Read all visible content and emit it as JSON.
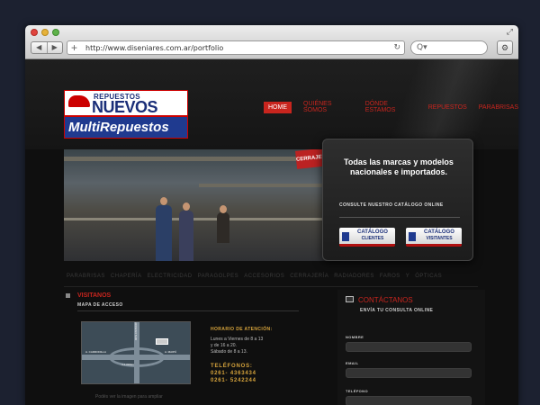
{
  "browser": {
    "url": "http://www.diseniares.com.ar/portfolio",
    "back_icon": "◀",
    "forward_icon": "▶",
    "add_icon": "+",
    "reload_icon": "↻",
    "search_icon": "Q▾",
    "settings_icon": "⚙",
    "fullscreen_icon": "⤢"
  },
  "logo": {
    "top_small": "REPUESTOS",
    "top_big": "NUEVOS",
    "bottom": "MultiRepuestos"
  },
  "nav": [
    "HOME",
    "QUIÉNES SOMOS",
    "DÓNDE ESTAMOS",
    "REPUESTOS",
    "PARABRISAS"
  ],
  "hero": {
    "sign": "CERRAJERÍA",
    "panel_title": "Todas las marcas y modelos nacionales e importados.",
    "panel_sub": "CONSULTE NUESTRO CATÁLOGO ONLINE",
    "btn_clientes_l1": "CATÁLOGO",
    "btn_clientes_l2": "CLIENTES",
    "btn_visitantes_l1": "CATÁLOGO",
    "btn_visitantes_l2": "VISITANTES"
  },
  "categories": [
    "PARABRISAS",
    "CHAPERÍA",
    "ELECTRICIDAD",
    "PARAGOLPES",
    "ACCESORIOS",
    "CERRAJERÍA",
    "RADIADORES",
    "FAROS",
    "Y",
    "ÓPTICAS"
  ],
  "visitantes": {
    "title": "VISITANOS",
    "mapa": "MAPA DE ACCESO",
    "map_labels": [
      "A. CARRODILLA",
      "J.J. PASO",
      "A. MAIPÚ",
      "ACCESO SUR"
    ],
    "horario_title": "HORARIO DE ATENCIÓN:",
    "horario_lines": [
      "Lunes a Viernes de 8 a 13",
      "y de 16 a 20.",
      "Sábado de 8 a 13."
    ],
    "tel_title": "TELÉFONOS:",
    "tel_lines": [
      "0261- 4363434",
      "0261- 5242244"
    ],
    "caption": "Podés ver la imagen para ampliar"
  },
  "contact": {
    "title": "CONTÁCTANOS",
    "sub": "ENVÍA TU CONSULTA ONLINE",
    "fields": [
      "NOMBRE",
      "EMAIL",
      "TELÉFONO"
    ]
  }
}
